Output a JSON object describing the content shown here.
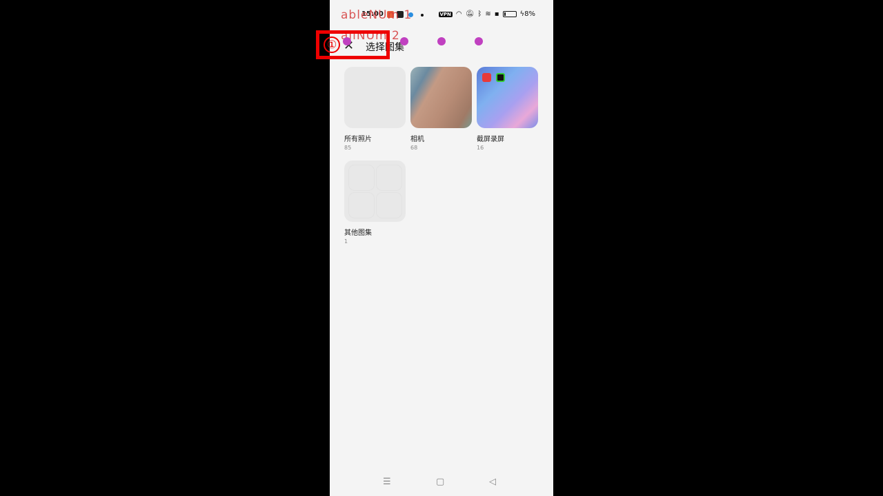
{
  "status_bar": {
    "time": "15:00",
    "vpn": "VPN",
    "battery": "8%"
  },
  "header": {
    "close_icon": "close-icon",
    "title": "选择图集"
  },
  "albums": [
    {
      "name": "所有照片",
      "count": "85"
    },
    {
      "name": "相机",
      "count": "68"
    },
    {
      "name": "截屏录屏",
      "count": "16"
    },
    {
      "name": "其他图集",
      "count": "1"
    }
  ],
  "nav": {
    "menu": "☰",
    "home": "▢",
    "back": "◁"
  },
  "overlay": {
    "label1": "ableNUm 1",
    "label2": "allNUm 2",
    "marker": "①",
    "dot_color": "#c040c0",
    "box_color": "#e00000"
  }
}
